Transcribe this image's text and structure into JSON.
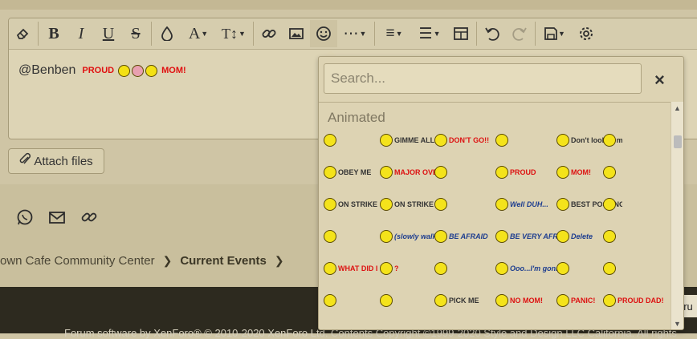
{
  "editor": {
    "toolbar": [
      {
        "name": "eraser-icon",
        "glyph": "⌫"
      },
      {
        "name": "bold-button",
        "glyph": "B"
      },
      {
        "name": "italic-button",
        "glyph": "I"
      },
      {
        "name": "underline-button",
        "glyph": "U"
      },
      {
        "name": "strikethrough-button",
        "glyph": "S"
      },
      {
        "name": "text-color-icon",
        "glyph": "💧"
      },
      {
        "name": "font-family-icon",
        "glyph": "A"
      },
      {
        "name": "font-size-icon",
        "glyph": "T↕"
      },
      {
        "name": "link-icon",
        "glyph": "🔗"
      },
      {
        "name": "image-icon",
        "glyph": "▣"
      },
      {
        "name": "smilie-icon",
        "glyph": "☺"
      },
      {
        "name": "more-icon",
        "glyph": "⋯"
      },
      {
        "name": "align-icon",
        "glyph": "≡"
      },
      {
        "name": "list-icon",
        "glyph": "☰"
      },
      {
        "name": "table-icon",
        "glyph": "⊞"
      },
      {
        "name": "undo-icon",
        "glyph": "↶"
      },
      {
        "name": "redo-icon",
        "glyph": "↷"
      },
      {
        "name": "drafts-icon",
        "glyph": "💾"
      },
      {
        "name": "settings-icon",
        "glyph": "⚙"
      }
    ],
    "content_mention": "@Benben",
    "content_proud": "PROUD",
    "content_mom": "MOM!"
  },
  "attach": {
    "label": "Attach files"
  },
  "breadcrumb": {
    "item1": "own Cafe Community Center",
    "item2": "Current Events"
  },
  "footer": {
    "text": "Forum software by XenForo® © 2010-2020 XenForo Ltd. Contents Copyright ©1999-2020 Style and Design LLC California. All rights"
  },
  "popup": {
    "search_placeholder": "Search...",
    "close": "×",
    "section": "Animated",
    "emotes": [
      {
        "label": "",
        "row": 0,
        "col": 0
      },
      {
        "label": "GIMME ALL YOUR CHOCOLATE",
        "row": 0,
        "col": 1
      },
      {
        "label": "DON'T GO!!",
        "row": 0,
        "col": 2
      },
      {
        "label": "",
        "row": 0,
        "col": 3
      },
      {
        "label": "Don't look at me...",
        "row": 0,
        "col": 4
      },
      {
        "label": "",
        "row": 0,
        "col": 5
      },
      {
        "label": "OBEY ME",
        "row": 1,
        "col": 0
      },
      {
        "label": "MAJOR OVERREACTION ALERT!",
        "row": 1,
        "col": 1
      },
      {
        "label": "",
        "row": 1,
        "col": 2
      },
      {
        "label": "PROUD",
        "row": 1,
        "col": 3
      },
      {
        "label": "MOM!",
        "row": 1,
        "col": 4
      },
      {
        "label": "",
        "row": 1,
        "col": 5
      },
      {
        "label": "ON STRIKE",
        "row": 2,
        "col": 0
      },
      {
        "label": "ON STRIKE",
        "row": 2,
        "col": 1
      },
      {
        "label": "",
        "row": 2,
        "col": 2
      },
      {
        "label": "Well DUH...",
        "row": 2,
        "col": 3
      },
      {
        "label": "BEST POSTING OF THE DAY",
        "row": 2,
        "col": 4
      },
      {
        "label": "",
        "row": 2,
        "col": 5
      },
      {
        "label": "",
        "row": 3,
        "col": 0
      },
      {
        "label": "(slowly walks backwards out of the room)",
        "row": 3,
        "col": 1
      },
      {
        "label": "BE AFRAID",
        "row": 3,
        "col": 2
      },
      {
        "label": "BE VERY AFRAID!!",
        "row": 3,
        "col": 3
      },
      {
        "label": "Delete",
        "row": 3,
        "col": 4
      },
      {
        "label": "",
        "row": 3,
        "col": 5
      },
      {
        "label": "WHAT DID I MISS?",
        "row": 4,
        "col": 0
      },
      {
        "label": "?",
        "row": 4,
        "col": 1
      },
      {
        "label": "",
        "row": 4,
        "col": 2
      },
      {
        "label": "Ooo...I'm gonna get you for that...",
        "row": 4,
        "col": 3
      },
      {
        "label": "",
        "row": 4,
        "col": 4
      },
      {
        "label": "",
        "row": 4,
        "col": 5
      },
      {
        "label": "",
        "row": 5,
        "col": 0
      },
      {
        "label": "",
        "row": 5,
        "col": 1
      },
      {
        "label": "PICK ME",
        "row": 5,
        "col": 2
      },
      {
        "label": "NO MOM!",
        "row": 5,
        "col": 3
      },
      {
        "label": "PANIC!",
        "row": 5,
        "col": 4
      },
      {
        "label": "PROUD DAD!",
        "row": 5,
        "col": 5
      }
    ]
  }
}
